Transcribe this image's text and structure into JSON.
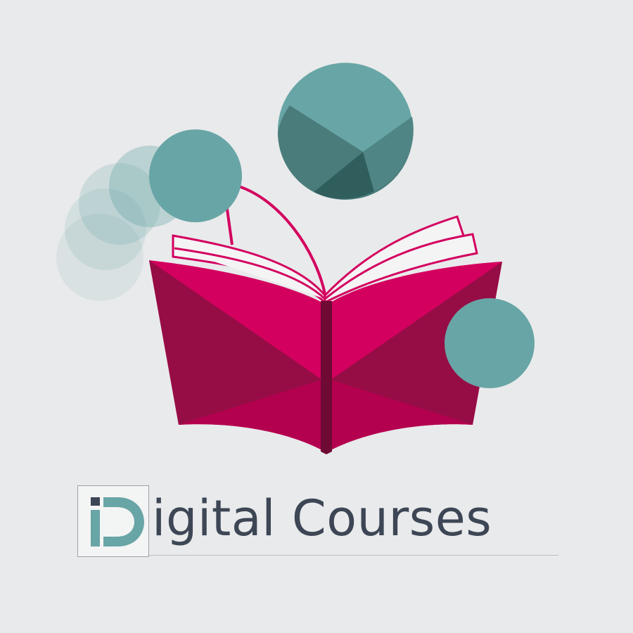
{
  "logo": {
    "brand_text": "igital Courses",
    "brand_mark_letter": "D",
    "icon_name": "open-book-icon"
  },
  "colors": {
    "background": "#e9eaeb",
    "book_magenta": "#d3005f",
    "book_dark": "#960d45",
    "book_medium": "#b3004f",
    "teal": "#68a5a6",
    "teal_dark": "#4a7c7b",
    "text_dark": "#3d4655"
  }
}
